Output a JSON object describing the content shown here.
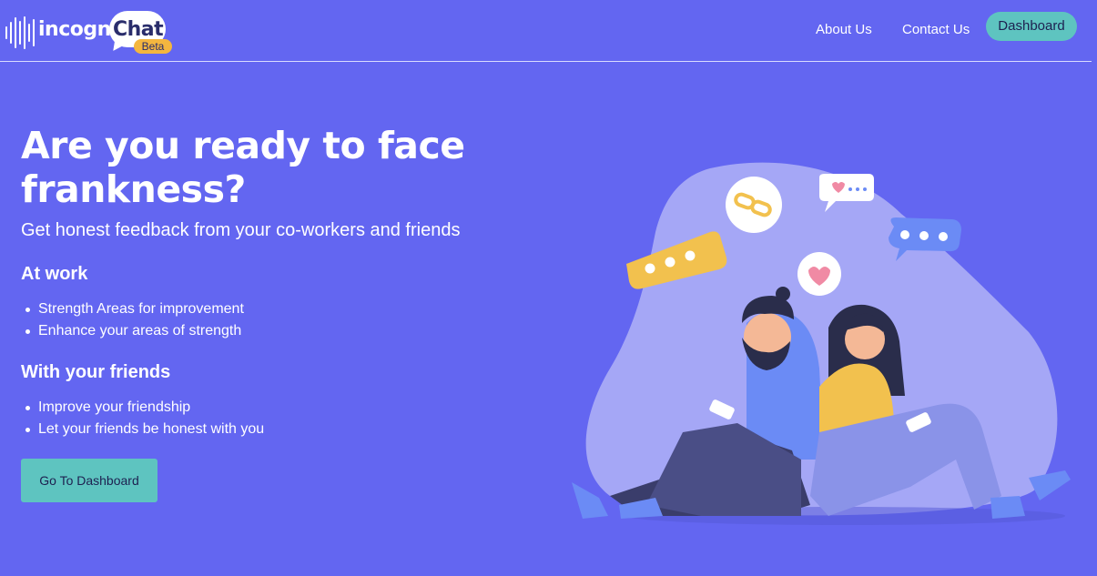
{
  "brand": {
    "name_part1": "incogni",
    "name_part2": "Chat",
    "badge": "Beta"
  },
  "nav": {
    "about": "About Us",
    "contact": "Contact Us",
    "dashboard": "Dashboard"
  },
  "hero": {
    "title": "Are you ready to face frankness?",
    "subtitle": "Get honest feedback from your co-workers and friends",
    "sections": [
      {
        "heading": "At work",
        "items": [
          "Strength Areas for improvement",
          "Enhance your areas of strength"
        ]
      },
      {
        "heading": "With your friends",
        "items": [
          "Improve your friendship",
          "Let your friends be honest with you"
        ]
      }
    ],
    "cta": "Go To Dashboard"
  },
  "colors": {
    "background": "#6366F1",
    "accent": "#5ec4c0",
    "blob": "#a5a7f6",
    "bubble_yellow": "#f2c14e",
    "bubble_blue": "#6b8bf5",
    "heart": "#f08aa4"
  },
  "illustration": {
    "icons": [
      "link-icon",
      "heart-icon",
      "chat-bubble-icon"
    ]
  }
}
